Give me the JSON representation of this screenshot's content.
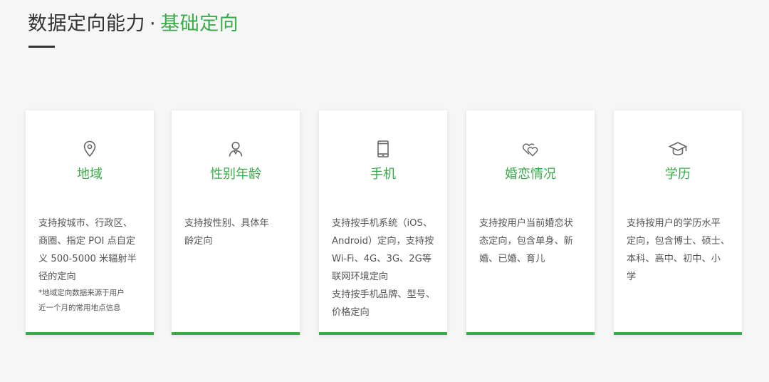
{
  "header": {
    "title_main": "数据定向能力",
    "title_separator": "·",
    "title_accent": "基础定向"
  },
  "colors": {
    "accent": "#3aaa4a",
    "text": "#333333",
    "body_text": "#555555",
    "background": "#f6f6f6"
  },
  "cards": [
    {
      "icon": "location-pin-icon",
      "title": "地域",
      "lines": [
        "支持按城市、行政区、",
        "商圈、指定 POI 点自定",
        "义 500-5000 米辐射半",
        "径的定向"
      ],
      "notes": [
        "*地域定向数据来源于用户",
        "近一个月的常用地点信息"
      ]
    },
    {
      "icon": "person-icon",
      "title": "性别年龄",
      "lines": [
        "支持按性别、具体年",
        "龄定向"
      ],
      "notes": []
    },
    {
      "icon": "mobile-phone-icon",
      "title": "手机",
      "lines": [
        "支持按手机系统（iOS、",
        "Android）定向，支持按",
        "Wi-Fi、4G、3G、2G等",
        "联网环境定向",
        "支持按手机品牌、型号、",
        "价格定向"
      ],
      "notes": []
    },
    {
      "icon": "double-heart-icon",
      "title": "婚恋情况",
      "lines": [
        "支持按用户当前婚恋状",
        "态定向，包含单身、新",
        "婚、已婚、育儿"
      ],
      "notes": []
    },
    {
      "icon": "graduation-cap-icon",
      "title": "学历",
      "lines": [
        "支持按用户的学历水平",
        "定向，包含博士、硕士、",
        "本科、高中、初中、小",
        "学"
      ],
      "notes": []
    }
  ]
}
